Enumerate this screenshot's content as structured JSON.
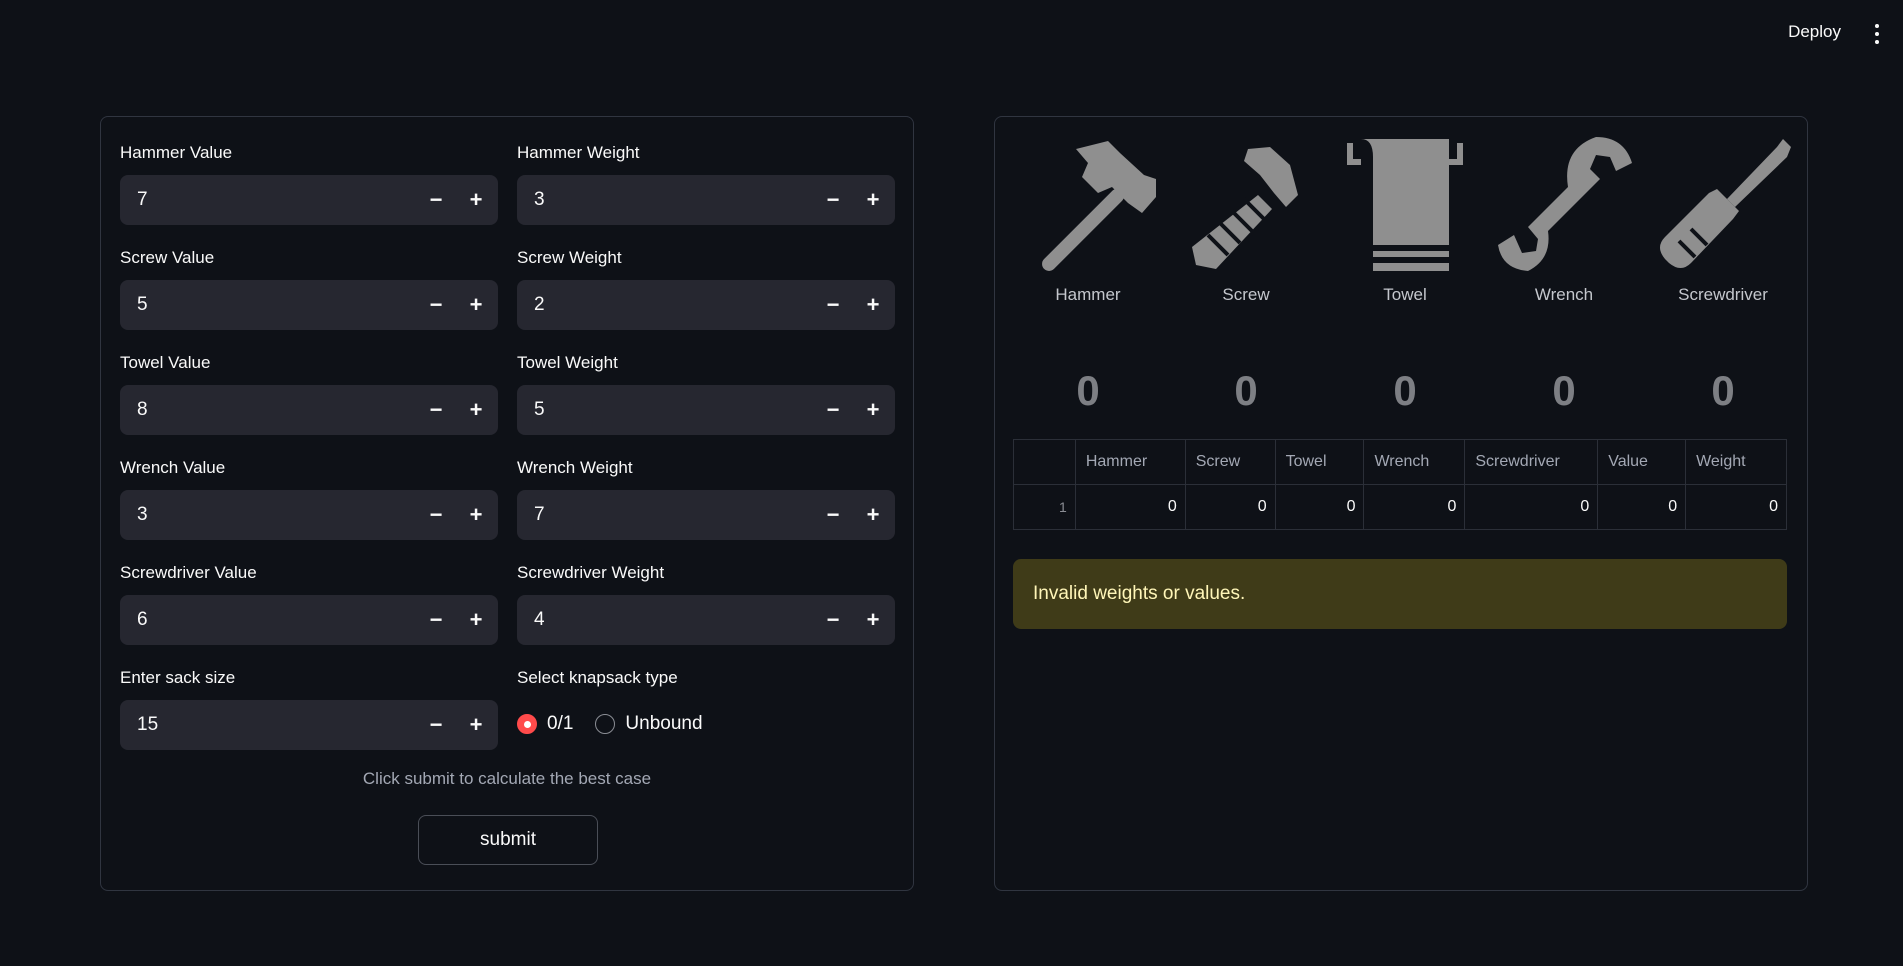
{
  "header": {
    "deploy_label": "Deploy"
  },
  "form": {
    "fields": [
      {
        "label": "Hammer Value",
        "value": "7"
      },
      {
        "label": "Hammer Weight",
        "value": "3"
      },
      {
        "label": "Screw Value",
        "value": "5"
      },
      {
        "label": "Screw Weight",
        "value": "2"
      },
      {
        "label": "Towel Value",
        "value": "8"
      },
      {
        "label": "Towel Weight",
        "value": "5"
      },
      {
        "label": "Wrench Value",
        "value": "3"
      },
      {
        "label": "Wrench Weight",
        "value": "7"
      },
      {
        "label": "Screwdriver Value",
        "value": "6"
      },
      {
        "label": "Screwdriver Weight",
        "value": "4"
      }
    ],
    "sack": {
      "label": "Enter sack size",
      "value": "15"
    },
    "knapsack_type": {
      "label": "Select knapsack type",
      "options": [
        "0/1",
        "Unbound"
      ],
      "selected": "0/1"
    },
    "minus_symbol": "−",
    "plus_symbol": "+",
    "hint": "Click submit to calculate the best case",
    "submit_label": "submit"
  },
  "results": {
    "items": [
      {
        "name": "Hammer",
        "icon": "hammer-icon",
        "count": "0"
      },
      {
        "name": "Screw",
        "icon": "screw-icon",
        "count": "0"
      },
      {
        "name": "Towel",
        "icon": "towel-icon",
        "count": "0"
      },
      {
        "name": "Wrench",
        "icon": "wrench-icon",
        "count": "0"
      },
      {
        "name": "Screwdriver",
        "icon": "screwdriver-icon",
        "count": "0"
      }
    ],
    "table": {
      "columns": [
        "",
        "Hammer",
        "Screw",
        "Towel",
        "Wrench",
        "Screwdriver",
        "Value",
        "Weight"
      ],
      "rows": [
        [
          "1",
          "0",
          "0",
          "0",
          "0",
          "0",
          "0",
          "0"
        ]
      ]
    },
    "alert": "Invalid weights or values."
  },
  "colors": {
    "background": "#0e1117",
    "input_bg": "#262730",
    "accent": "#ff4b4b",
    "icon_gray": "#8f8f8f",
    "warning_bg": "#3f3b18",
    "warning_text": "#fff6b8"
  }
}
